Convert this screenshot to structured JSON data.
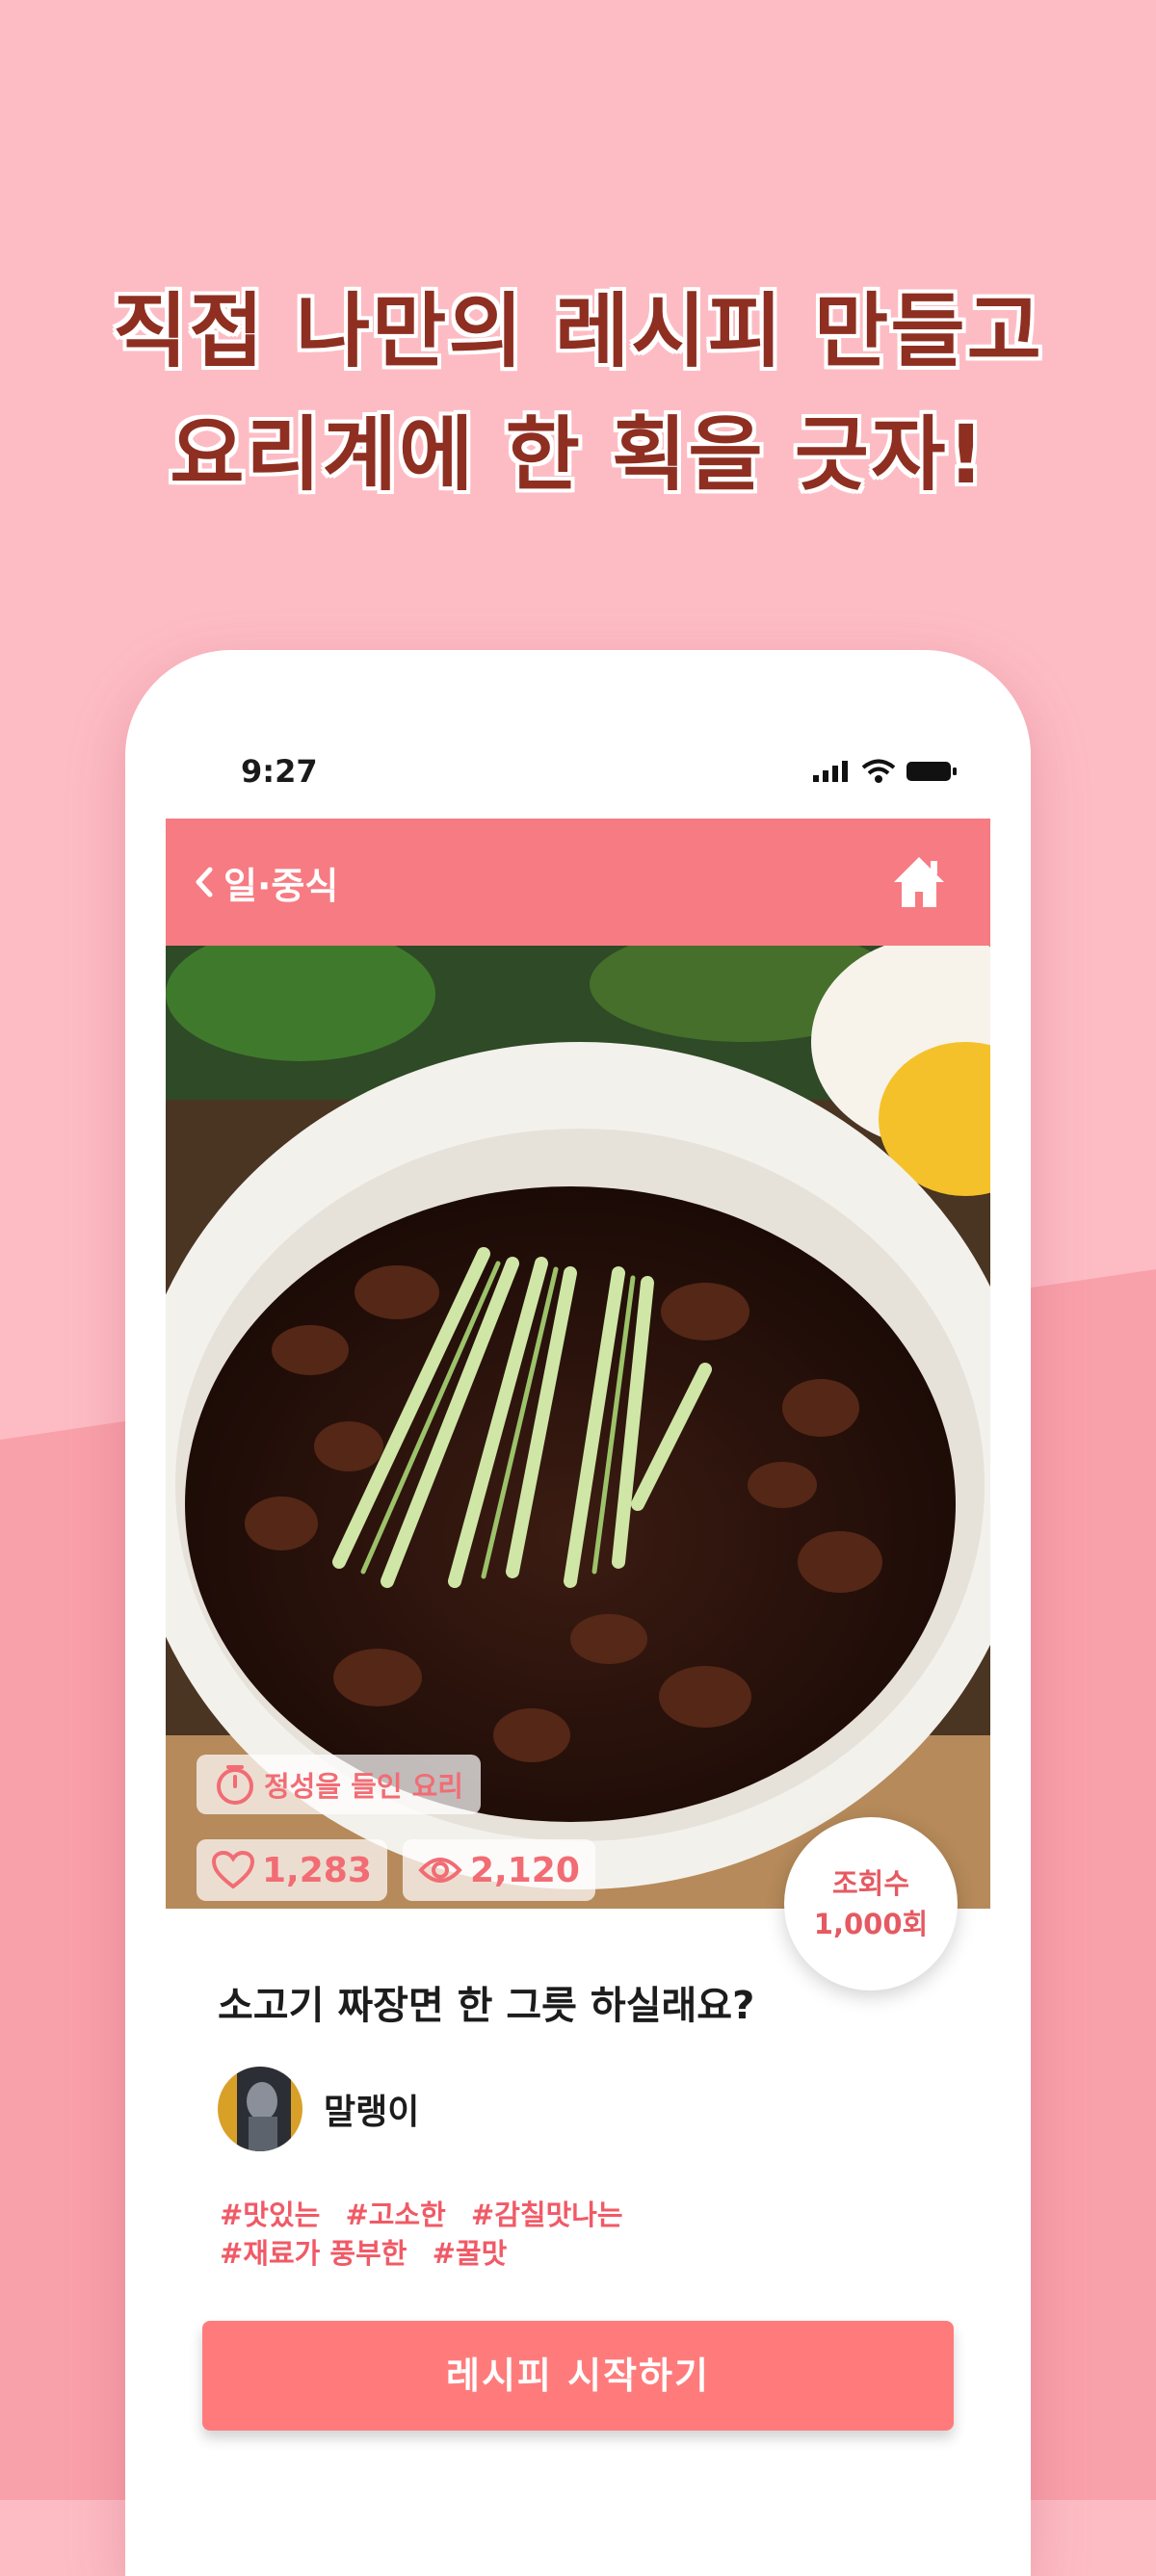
{
  "promo": {
    "headline_line1": "직접 나만의 레시피 만들고",
    "headline_line2": "요리계에 한 획을 긋자!"
  },
  "colors": {
    "background": "#FDBCC4",
    "background_lower": "#F9A1AB",
    "accent": "#F77B82",
    "cta": "#FF7B7B",
    "headline": "#8E2F22",
    "tag_text": "#F05A66"
  },
  "status_bar": {
    "time": "9:27",
    "icons": [
      "signal-icon",
      "wifi-icon",
      "battery-icon"
    ]
  },
  "nav": {
    "back_label": "일·중식",
    "back_icon": "chevron-left-icon",
    "home_icon": "home-icon"
  },
  "recipe": {
    "badge_label": "정성을 들인 요리",
    "badge_icon": "timer-icon",
    "likes": "1,283",
    "views": "2,120",
    "view_count_label": "조회수",
    "view_count_value": "1,000회",
    "title": "소고기 짜장면 한 그릇 하실래요?",
    "author": "말랭이",
    "tags_line1": [
      "#맛있는",
      "#고소한",
      "#감칠맛나는"
    ],
    "tags_line2": [
      "#재료가 풍부한",
      "#꿀맛"
    ],
    "cta_label": "레시피 시작하기"
  }
}
